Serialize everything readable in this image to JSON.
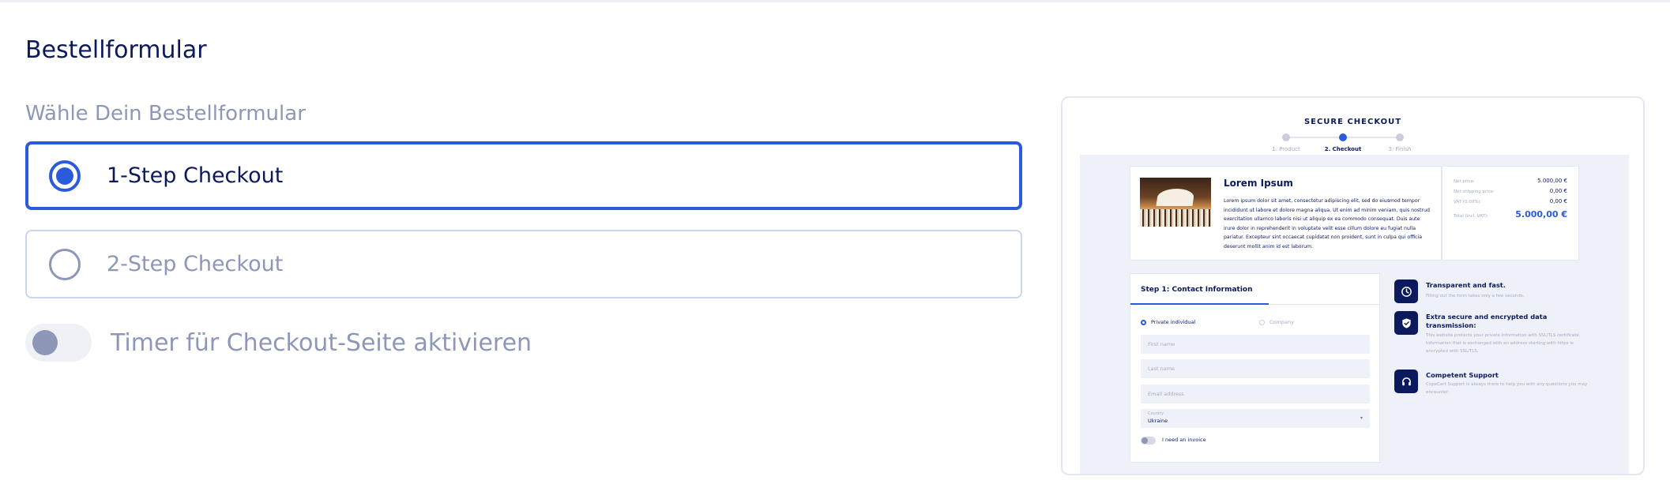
{
  "title": "Bestellformular",
  "subtitle": "Wähle Dein Bestellformular",
  "options": [
    {
      "label": "1-Step Checkout",
      "selected": true
    },
    {
      "label": "2-Step Checkout",
      "selected": false
    }
  ],
  "timer": {
    "label": "Timer für Checkout-Seite aktivieren",
    "enabled": false
  },
  "preview": {
    "heading": "SECURE CHECKOUT",
    "steps": [
      "1. Product",
      "2. Checkout",
      "3. Finish"
    ],
    "active_step": 1,
    "product": {
      "name": "Lorem Ipsum",
      "description": "Lorem ipsum dolor sit amet, consectetur adipiscing elit, sed do eiusmod tempor incididunt ut labore et dolore magna aliqua. Ut enim ad minim veniam, quis nostrud exercitation ullamco laboris nisi ut aliquip ex ea commodo consequat. Duis aute irure dolor in reprehenderit in voluptate velit esse cillum dolore eu fugiat nulla pariatur. Excepteur sint occaecat cupidatat non proident, sunt in culpa qui officia deserunt mollit anim id est laborum."
    },
    "prices": [
      {
        "label": "Net price:",
        "value": "5.000,00 €"
      },
      {
        "label": "Net shipping price:",
        "value": "0,00 €"
      },
      {
        "label": "VAT (0.00%):",
        "value": "0,00 €"
      },
      {
        "label": "Total (incl. VAT):",
        "value": "5.000,00 €"
      }
    ],
    "form": {
      "title": "Step 1: Contact Information",
      "radio_private": "Private individual",
      "radio_company": "Company",
      "first_name": "First name",
      "last_name": "Last name",
      "email": "Email address",
      "country_label": "Country",
      "country_value": "Ukraine",
      "invoice_label": "I need an invoice"
    },
    "features": [
      {
        "icon": "clock-icon",
        "title": "Transparent and fast.",
        "desc": "Filling out the form takes only a few seconds."
      },
      {
        "icon": "shield-check-icon",
        "title": "Extra secure and encrypted data transmission:",
        "desc": "This website protects your private information with SSL/TLS certificate. Information that is exchanged with an address starting with https is encrypted with SSL/TLS."
      },
      {
        "icon": "headset-icon",
        "title": "Competent Support",
        "desc": "CopeCart Support is always there to help you with any questions you may encounter."
      }
    ],
    "colors": {
      "accent": "#2a5bdc",
      "navy": "#0b1a5c",
      "muted": "#8d97b8"
    }
  }
}
